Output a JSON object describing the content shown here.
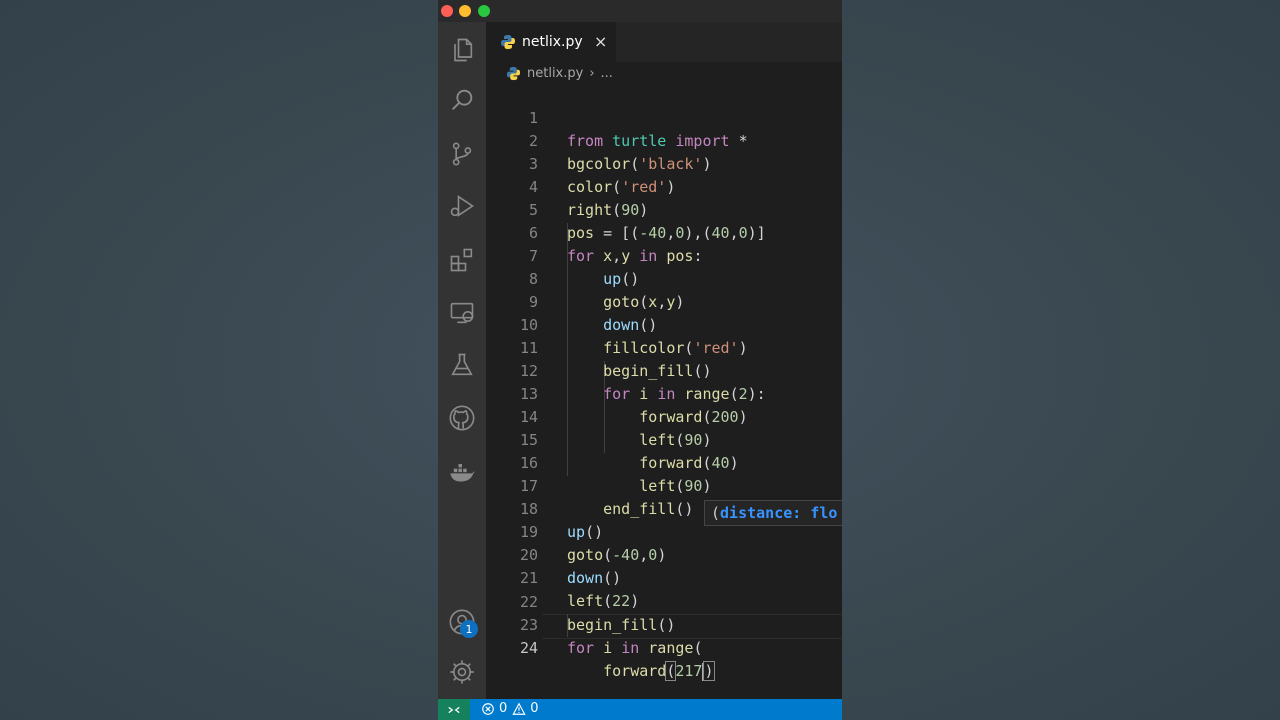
{
  "window": {
    "traffic_lights": [
      "close",
      "minimize",
      "zoom"
    ]
  },
  "activity_bar": {
    "items": [
      {
        "icon": "files-icon"
      },
      {
        "icon": "search-icon"
      },
      {
        "icon": "source-control-icon"
      },
      {
        "icon": "run-debug-icon"
      },
      {
        "icon": "extensions-icon"
      },
      {
        "icon": "remote-explorer-icon"
      },
      {
        "icon": "testing-icon"
      },
      {
        "icon": "github-icon"
      },
      {
        "icon": "docker-icon"
      }
    ],
    "accounts_badge": "1",
    "bottom_items": [
      {
        "icon": "accounts-icon"
      },
      {
        "icon": "gear-icon"
      }
    ]
  },
  "tabs": [
    {
      "label": "netlix.py",
      "active": true,
      "close": "×"
    }
  ],
  "breadcrumb": {
    "file": "netlix.py",
    "separator": "›",
    "more": "..."
  },
  "editor": {
    "line_numbers": [
      "1",
      "2",
      "3",
      "4",
      "5",
      "6",
      "7",
      "8",
      "9",
      "10",
      "11",
      "12",
      "13",
      "14",
      "15",
      "16",
      "17",
      "18",
      "19",
      "20",
      "21",
      "22",
      "23",
      "24"
    ],
    "active_line": "24",
    "lines": [
      "from turtle import *",
      "bgcolor('black')",
      "color('red')",
      "right(90)",
      "pos = [(-40,0),(40,0)]",
      "for x,y in pos:",
      "    up()",
      "    goto(x,y)",
      "    down()",
      "    fillcolor('red')",
      "    begin_fill()",
      "    for i in range(2):",
      "        forward(200)",
      "        left(90)",
      "        forward(40)",
      "        left(90)",
      "    end_fill()",
      "up()",
      "goto(-40,0)",
      "down()",
      "left(22)",
      "begin_fill()",
      "for i in range(",
      "    forward(217)"
    ]
  },
  "parameter_hint": {
    "open": "(",
    "param": "distance: flo"
  },
  "statusbar": {
    "errors": "0",
    "warnings": "0"
  },
  "colors": {
    "keyword": "#c586c0",
    "function": "#dcdcaa",
    "string": "#ce9178",
    "number": "#b5cea8",
    "variable": "#9cdcfe",
    "module": "#4ec9b0",
    "statusbar": "#007acc",
    "remote": "#16825d"
  }
}
